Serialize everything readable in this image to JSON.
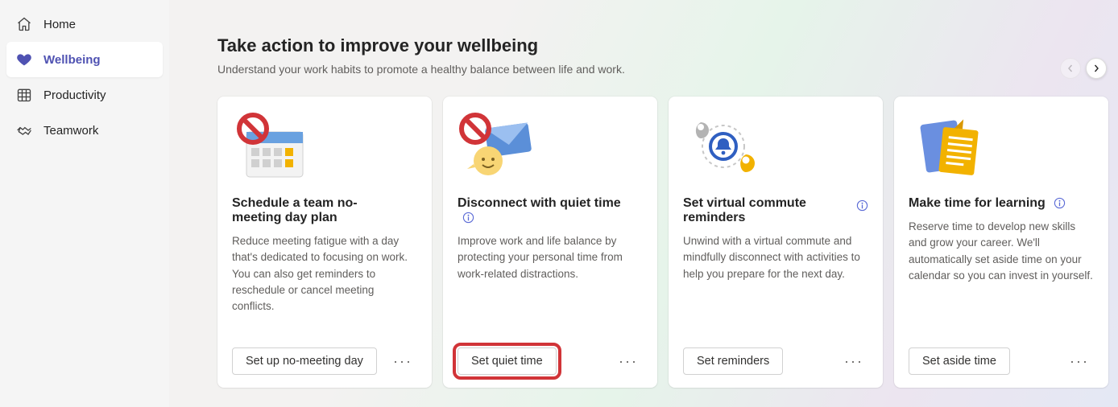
{
  "sidebar": {
    "items": [
      {
        "label": "Home",
        "active": false
      },
      {
        "label": "Wellbeing",
        "active": true
      },
      {
        "label": "Productivity",
        "active": false
      },
      {
        "label": "Teamwork",
        "active": false
      }
    ]
  },
  "header": {
    "title": "Take action to improve your wellbeing",
    "subtitle": "Understand your work habits to promote a healthy balance between life and work."
  },
  "cards": [
    {
      "title": "Schedule a team no-meeting day plan",
      "description": "Reduce meeting fatigue with a day that's dedicated to focusing on work. You can also get reminders to reschedule or cancel meeting conflicts.",
      "action_label": "Set up no-meeting day",
      "has_info": false,
      "highlighted": false
    },
    {
      "title": "Disconnect with quiet time",
      "description": "Improve work and life balance by protecting your personal time from work-related distractions.",
      "action_label": "Set quiet time",
      "has_info": true,
      "highlighted": true
    },
    {
      "title": "Set virtual commute reminders",
      "description": "Unwind with a virtual commute and mindfully disconnect with activities to help you prepare for the next day.",
      "action_label": "Set reminders",
      "has_info": true,
      "highlighted": false
    },
    {
      "title": "Make time for learning",
      "description": "Reserve time to develop new skills and grow your career. We'll automatically set aside time on your calendar so you can invest in yourself.",
      "action_label": "Set aside time",
      "has_info": true,
      "highlighted": false
    }
  ],
  "icons": {
    "more_label": "···"
  }
}
